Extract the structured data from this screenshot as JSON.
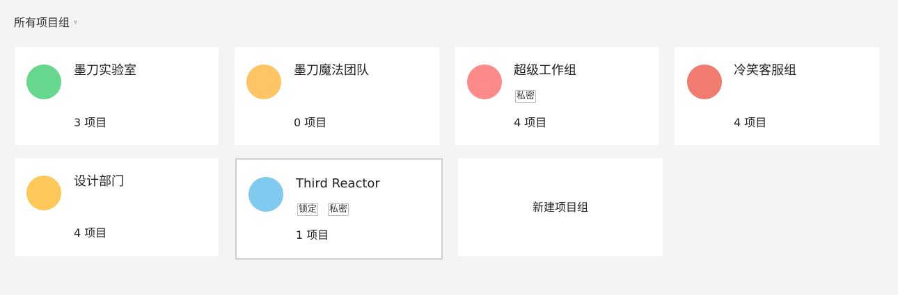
{
  "filter": {
    "label": "所有项目组",
    "caret": "▿"
  },
  "groups": [
    {
      "name": "墨刀实验室",
      "count": "3 项目",
      "color": "#66d78c",
      "tags": []
    },
    {
      "name": "墨刀魔法团队",
      "count": "0 项目",
      "color": "#ffc564",
      "tags": []
    },
    {
      "name": "超级工作组",
      "count": "4 项目",
      "color": "#ff8a8a",
      "tags": [
        "私密"
      ]
    },
    {
      "name": "冷笑客服组",
      "count": "4 项目",
      "color": "#f07b6f",
      "tags": []
    },
    {
      "name": "设计部门",
      "count": "4 项目",
      "color": "#ffc85a",
      "tags": []
    },
    {
      "name": "Third Reactor",
      "count": "1 项目",
      "color": "#80caef",
      "tags": [
        "锁定",
        "私密"
      ]
    }
  ],
  "new_group": {
    "label": "新建项目组"
  }
}
